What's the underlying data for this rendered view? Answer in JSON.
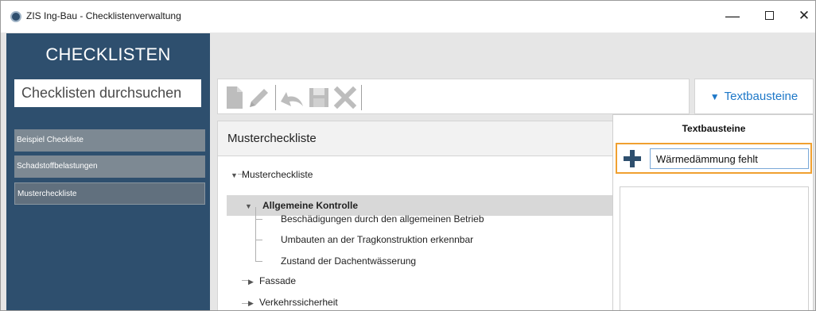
{
  "window": {
    "title": "ZIS Ing-Bau - Checklistenverwaltung",
    "minimize_glyph": "—",
    "close_glyph": "✕"
  },
  "sidebar": {
    "title": "CHECKLISTEN",
    "search_placeholder": "Checklisten durchsuchen",
    "items": [
      {
        "label": "Beispiel Checkliste"
      },
      {
        "label": "Schadstoffbelastungen"
      },
      {
        "label": "Mustercheckliste",
        "selected": true
      }
    ]
  },
  "toolbar": {
    "icons": [
      "new-document-icon",
      "edit-pencil-icon",
      "undo-icon",
      "save-icon",
      "delete-icon"
    ],
    "textbausteine_label": "Textbausteine"
  },
  "main": {
    "header": "Mustercheckliste",
    "tree": {
      "root": "Mustercheckliste",
      "selected": "Allgemeine Kontrolle",
      "children": [
        "Beschädigungen durch den allgemeinen Betrieb",
        "Umbauten an der Tragkonstruktion erkennbar",
        "Zustand der Dachentwässerung"
      ],
      "siblings": [
        "Fassade",
        "Verkehrssicherheit"
      ]
    }
  },
  "textbausteine_panel": {
    "title": "Textbausteine",
    "input_value": "Wärmedämmung fehlt"
  },
  "colors": {
    "sidebar_bg": "#2e4f6e",
    "accent_blue": "#1e78c8",
    "highlight_orange": "#f0a030",
    "selected_row": "#d8d8d8"
  }
}
